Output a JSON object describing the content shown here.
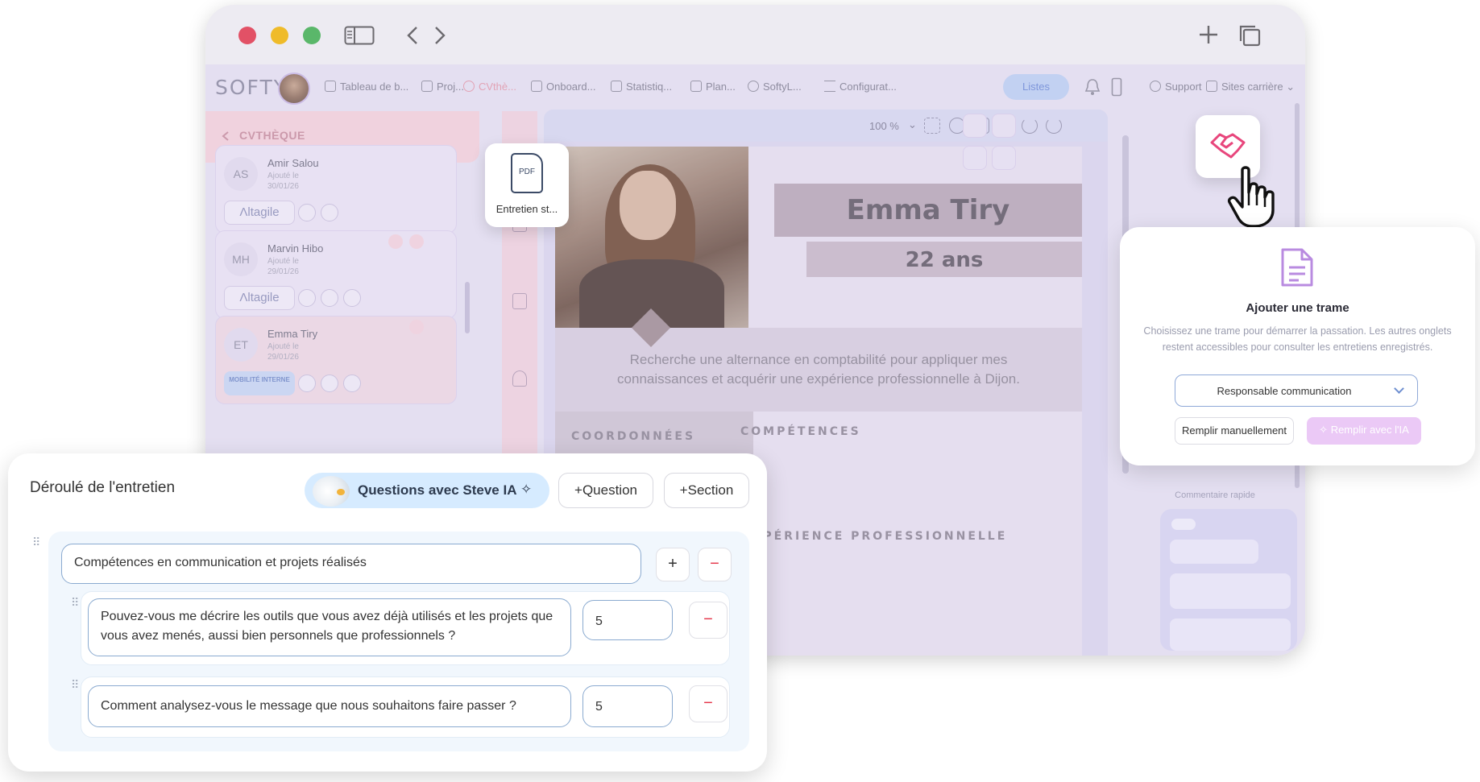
{
  "nav": {
    "logo": "SOFTY",
    "items": [
      "Tableau de b...",
      "Proj...",
      "CVthè...",
      "Onboard...",
      "Statistiq...",
      "Plan...",
      "SoftyL...",
      "Configurat..."
    ],
    "listes": "Listes",
    "support": "Support",
    "sites": "Sites carrière"
  },
  "cvtheque": {
    "header": "CVTHÈQUE",
    "candidates": [
      {
        "initials": "AS",
        "name": "Amir Salou",
        "added": "Ajouté le",
        "date": "30/01/26",
        "tag": "Λltagile"
      },
      {
        "initials": "MH",
        "name": "Marvin Hibo",
        "added": "Ajouté le",
        "date": "29/01/26",
        "tag": "Λltagile"
      },
      {
        "initials": "ET",
        "name": "Emma Tiry",
        "added": "Ajouté le",
        "date": "29/01/26",
        "tag": "MOBILITÉ INTERNE"
      }
    ]
  },
  "viewer": {
    "zoom": "100 %"
  },
  "pdf_card": {
    "badge": "PDF",
    "label": "Entretien st..."
  },
  "cv": {
    "name": "Emma Tiry",
    "age": "22 ans",
    "summary": "Recherche une alternance en comptabilité pour appliquer mes connaissances et acquérir une expérience professionnelle à Dijon.",
    "sections": [
      "COORDONNÉES",
      "COMPÉTENCES",
      "EXPÉRIENCE PROFESSIONNELLE"
    ]
  },
  "right_panel": {
    "quick_comment": "Commentaire rapide"
  },
  "template": {
    "title": "Ajouter une trame",
    "description": "Choisissez une trame pour démarrer la passation. Les autres onglets restent accessibles pour consulter les entretiens enregistrés.",
    "selected": "Responsable communication",
    "manual_button": "Remplir manuellement",
    "ai_button": "Remplir avec l'IA"
  },
  "interview": {
    "title": "Déroulé de l'entretien",
    "steve_button": "Questions avec Steve IA",
    "question_button": "Question",
    "section_button": "Section",
    "section_title": "Compétences en communication et projets réalisés",
    "questions": [
      {
        "text": "Pouvez-vous me décrire les outils que vous avez déjà utilisés et les projets que vous avez menés, aussi bien personnels que professionnels ?",
        "score": "5"
      },
      {
        "text": "Comment analysez-vous le message que nous souhaitons faire passer ?",
        "score": "5"
      }
    ]
  },
  "colors": {
    "accent_pink": "#e8467c",
    "accent_blue": "#8aaad0",
    "lavender": "#e7e3f3",
    "close": "#e5364a",
    "minimize": "#f5b800",
    "maximize": "#3fb34f"
  }
}
